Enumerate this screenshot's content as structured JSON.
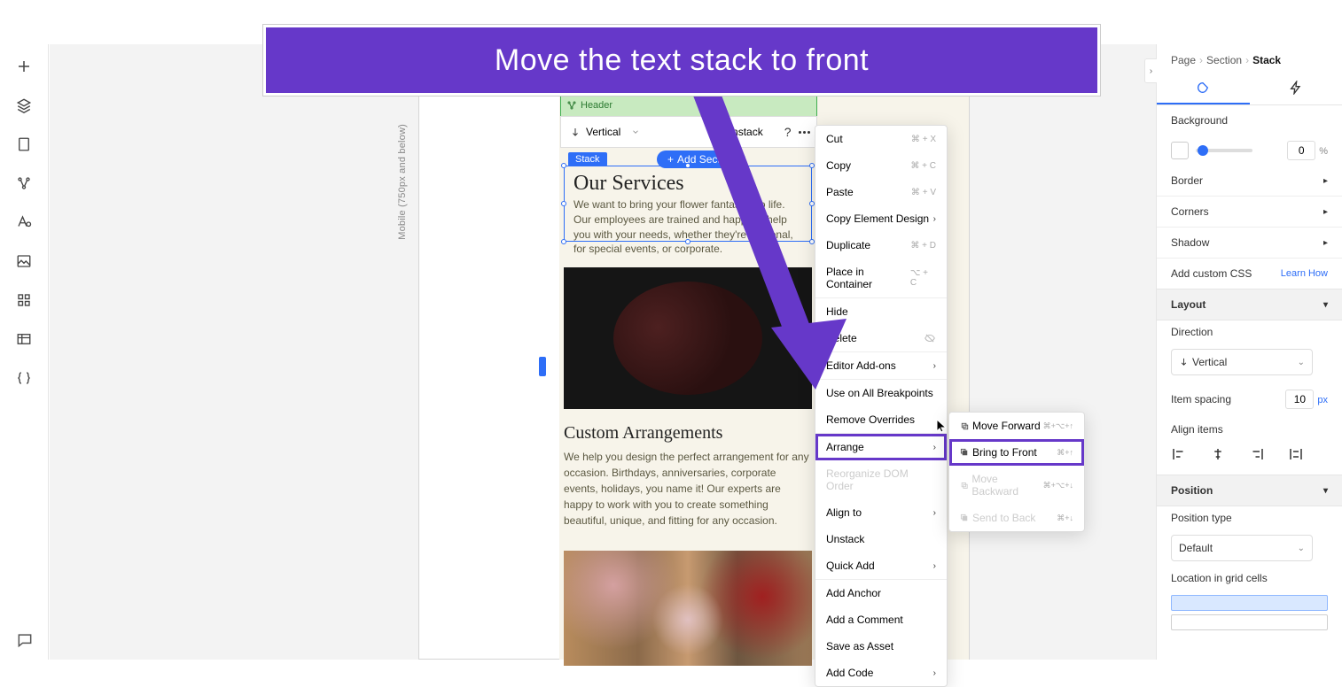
{
  "banner": {
    "text": "Move the text stack to front"
  },
  "leftRail": {
    "icons": [
      "plus",
      "layers",
      "page",
      "connect",
      "font",
      "image",
      "grid",
      "table",
      "code"
    ],
    "chat": "chat"
  },
  "mobileLabel": "Mobile (750px and below)",
  "headerBand": "Header",
  "toolbar": {
    "direction": "Vertical",
    "unstack": "Unstack"
  },
  "stackTag": "Stack",
  "addSection": "Add Section",
  "services": {
    "title": "Our Services",
    "body": "We want to bring your flower fantasies to life. Our employees are trained and happy to help you with your needs, whether they're personal, for special events, or corporate."
  },
  "custom": {
    "title": "Custom Arrangements",
    "body": "We help you design the perfect arrangement for any occasion. Birthdays, anniversaries, corporate events, holidays, you name it! Our experts are happy to work with you to create something beautiful, unique, and fitting for any occasion."
  },
  "ctx": {
    "cut": "Cut",
    "cut_sc": "⌘ + X",
    "copy": "Copy",
    "copy_sc": "⌘ + C",
    "paste": "Paste",
    "paste_sc": "⌘ + V",
    "copyDesign": "Copy Element Design",
    "duplicate": "Duplicate",
    "dup_sc": "⌘ + D",
    "place": "Place in Container",
    "place_sc": "⌥ + C",
    "hide": "Hide",
    "delete": "Delete",
    "addons": "Editor Add-ons",
    "breakpoints": "Use on All Breakpoints",
    "removeOverrides": "Remove Overrides",
    "arrange": "Arrange",
    "reorg": "Reorganize DOM Order",
    "alignTo": "Align to",
    "unstack": "Unstack",
    "quickAdd": "Quick Add",
    "addAnchor": "Add Anchor",
    "addComment": "Add a Comment",
    "saveAsset": "Save as Asset",
    "addCode": "Add Code"
  },
  "sub": {
    "moveForward": "Move Forward",
    "mf_sc": "⌘+⌥+↑",
    "bringFront": "Bring to Front",
    "bf_sc": "⌘+↑",
    "moveBackward": "Move Backward",
    "mb_sc": "⌘+⌥+↓",
    "sendBack": "Send to Back",
    "sb_sc": "⌘+↓"
  },
  "right": {
    "crumb": {
      "p": "Page",
      "s": "Section",
      "k": "Stack"
    },
    "background": "Background",
    "bg_val": "0",
    "bg_unit": "%",
    "border": "Border",
    "corners": "Corners",
    "shadow": "Shadow",
    "addCss": "Add custom CSS",
    "learn": "Learn How",
    "layout": "Layout",
    "direction": "Direction",
    "direction_val": "Vertical",
    "itemSpacing": "Item spacing",
    "spacing_val": "10",
    "spacing_unit": "px",
    "alignItems": "Align items",
    "position": "Position",
    "positionType": "Position type",
    "positionType_val": "Default",
    "location": "Location in grid cells"
  }
}
